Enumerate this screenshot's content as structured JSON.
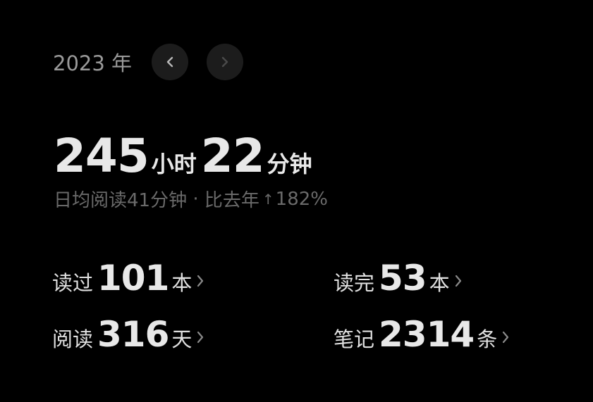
{
  "header": {
    "year": "2023 年"
  },
  "total": {
    "hours": "245",
    "hours_unit": "小时",
    "minutes": "22",
    "minutes_unit": "分钟"
  },
  "summary": {
    "daily_avg": "日均阅读41分钟",
    "separator": " · ",
    "compare_label": "比去年",
    "arrow": "↑",
    "change": "182%"
  },
  "stats": {
    "read": {
      "label": "读过",
      "value": "101",
      "unit": "本"
    },
    "finished": {
      "label": "读完",
      "value": "53",
      "unit": "本"
    },
    "days": {
      "label": "阅读",
      "value": "316",
      "unit": "天"
    },
    "notes": {
      "label": "笔记",
      "value": "2314",
      "unit": "条"
    }
  },
  "icons": {
    "prev": "chevron-left-icon",
    "next": "chevron-right-icon",
    "stat_link": "chevron-right-icon"
  },
  "colors": {
    "background": "#000000",
    "text": "#e8e8e8",
    "muted": "#6a6a6a",
    "button_bg": "#1c1c1c"
  }
}
